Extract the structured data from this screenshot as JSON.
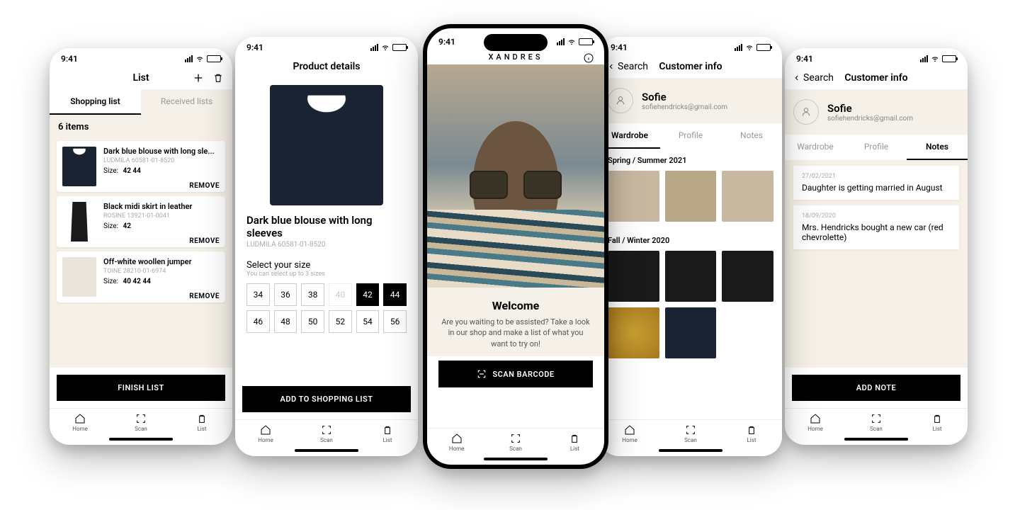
{
  "status": {
    "time": "9:41"
  },
  "nav": {
    "home": "Home",
    "scan": "Scan",
    "list": "List"
  },
  "phone1": {
    "title": "List",
    "tab_shopping": "Shopping list",
    "tab_received": "Received lists",
    "count": "6 items",
    "items": [
      {
        "name": "Dark blue blouse with long sle...",
        "sku": "LUDMILA 60581-01-8520",
        "size_label": "Size:",
        "sizes": "42  44"
      },
      {
        "name": "Black midi skirt in leather",
        "sku": "ROSINE 13921-01-0041",
        "size_label": "Size:",
        "sizes": "42"
      },
      {
        "name": "Off-white woollen jumper",
        "sku": "TOINE 28210-01-6974",
        "size_label": "Size:",
        "sizes": "40  42  44"
      }
    ],
    "remove": "REMOVE",
    "finish": "FINISH LIST"
  },
  "phone2": {
    "title": "Product details",
    "name": "Dark blue blouse with long sleeves",
    "sku": "LUDMILA 60581-01-8520",
    "size_label": "Select your size",
    "size_hint": "You can select up to 3 sizes",
    "sizes": [
      "34",
      "36",
      "38",
      "40",
      "42",
      "44",
      "46",
      "48",
      "50",
      "52",
      "54",
      "56"
    ],
    "unavailable": [
      "40"
    ],
    "selected": [
      "42",
      "44"
    ],
    "cta": "ADD TO SHOPPING LIST"
  },
  "phone3": {
    "brand": "XANDRES",
    "welcome_title": "Welcome",
    "welcome_text": "Are you waiting to be assisted? Take a look in our shop and make a list of what you want to try on!",
    "scan": "SCAN BARCODE"
  },
  "phone4": {
    "back": "Search",
    "title": "Customer info",
    "name": "Sofie",
    "email": "sofiehendricks@gmail.com",
    "tab_wardrobe": "Wardrobe",
    "tab_profile": "Profile",
    "tab_notes": "Notes",
    "season1": "Spring / Summer 2021",
    "season2": "Fall / Winter 2020"
  },
  "phone5": {
    "back": "Search",
    "title": "Customer info",
    "name": "Sofie",
    "email": "sofiehendricks@gmail.com",
    "tab_wardrobe": "Wardrobe",
    "tab_profile": "Profile",
    "tab_notes": "Notes",
    "notes": [
      {
        "date": "27/02/2021",
        "text": "Daughter is getting married in August"
      },
      {
        "date": "18/09/2020",
        "text": "Mrs. Hendricks bought a new car (red chevrolette)"
      }
    ],
    "cta": "ADD NOTE"
  }
}
